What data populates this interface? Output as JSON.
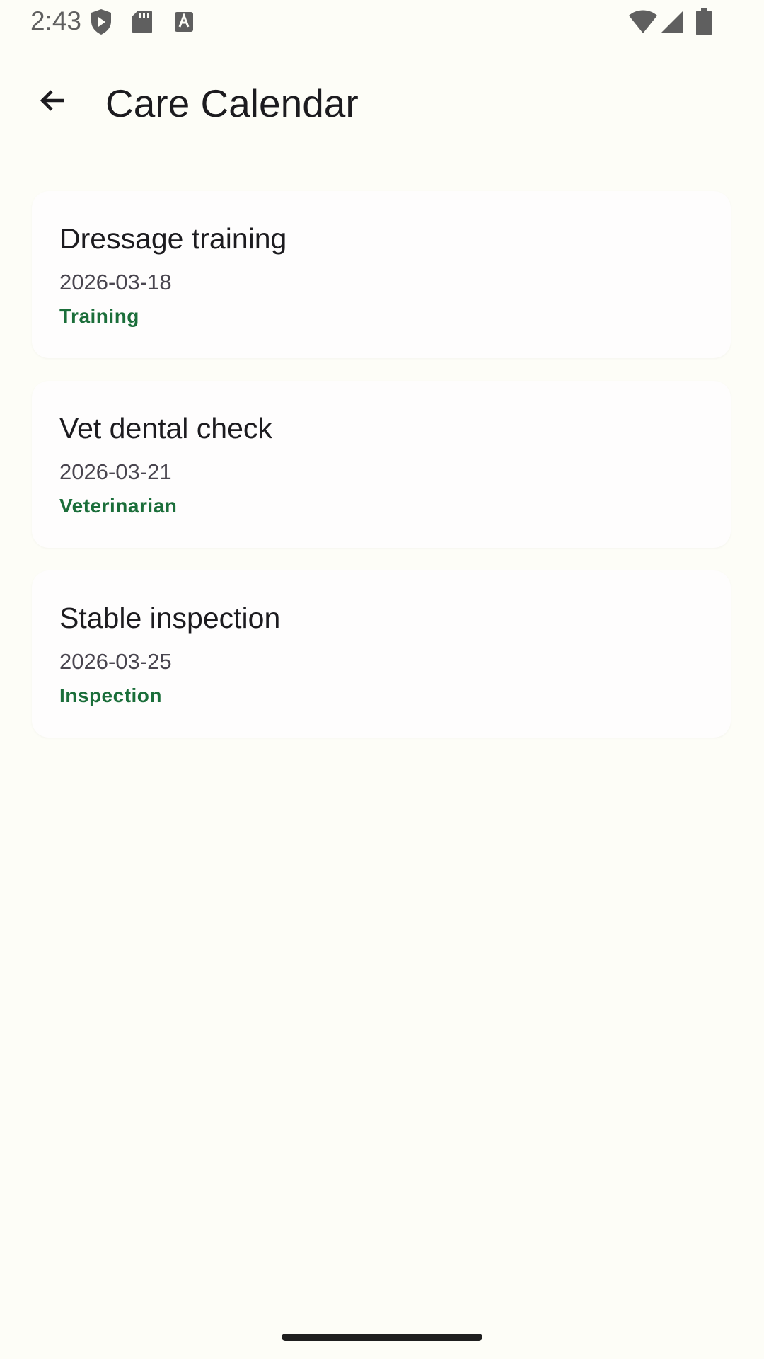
{
  "status_bar": {
    "time": "2:43",
    "icons": [
      "shield-play-icon",
      "sd-card-icon",
      "font-a-icon",
      "wifi-icon",
      "signal-icon",
      "battery-icon"
    ]
  },
  "app_bar": {
    "back_icon": "arrow-back-icon",
    "title": "Care Calendar"
  },
  "events": [
    {
      "title": "Dressage training",
      "date": "2026-03-18",
      "category": "Training"
    },
    {
      "title": "Vet dental check",
      "date": "2026-03-21",
      "category": "Veterinarian"
    },
    {
      "title": "Stable inspection",
      "date": "2026-03-25",
      "category": "Inspection"
    }
  ],
  "colors": {
    "background": "#fdfdf7",
    "category_accent": "#1b6e3a",
    "title_text": "#1c1b1f",
    "secondary_text": "#49454f"
  }
}
